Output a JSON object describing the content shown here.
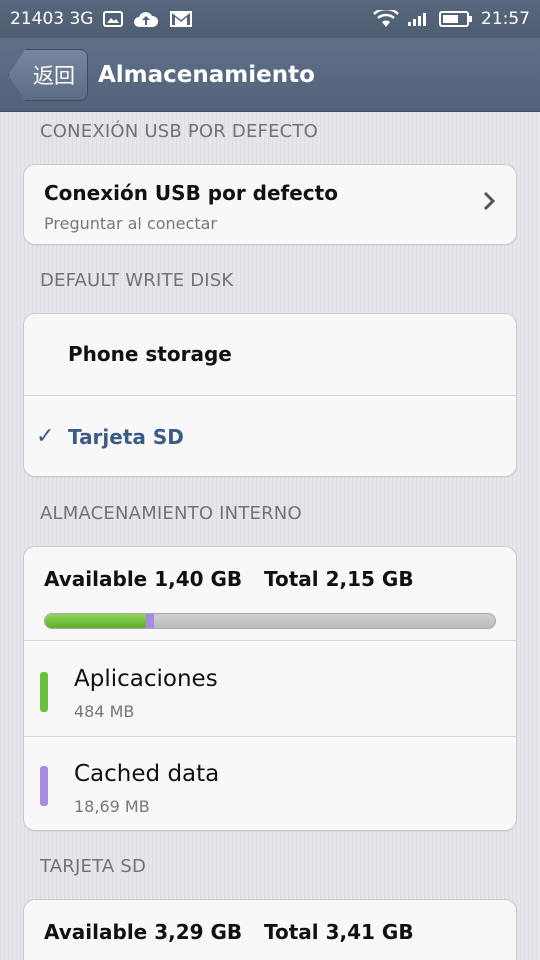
{
  "status_bar": {
    "carrier": "21403 3G",
    "time": "21:57",
    "icons": [
      "image-icon",
      "cloud-upload-icon",
      "gmail-icon",
      "wifi-icon",
      "signal-icon",
      "battery-icon"
    ]
  },
  "title_bar": {
    "back_label": "返回",
    "title": "Almacenamiento"
  },
  "sections": {
    "usb": {
      "header": "CONEXIÓN USB POR DEFECTO",
      "item_title": "Conexión USB por defecto",
      "item_subtitle": "Preguntar al conectar"
    },
    "write_disk": {
      "header": "DEFAULT WRITE DISK",
      "options": [
        {
          "label": "Phone storage",
          "selected": false
        },
        {
          "label": "Tarjeta SD",
          "selected": true
        }
      ],
      "check_glyph": "✓"
    },
    "internal": {
      "header": "ALMACENAMIENTO INTERNO",
      "available": "Available 1,40 GB",
      "total": "Total 2,15 GB",
      "usage": {
        "apps_fraction": 0.225,
        "cache_fraction": 0.018
      },
      "items": [
        {
          "title": "Aplicaciones",
          "size": "484 MB",
          "color": "#6cc13a"
        },
        {
          "title": "Cached data",
          "size": "18,69 MB",
          "color": "#a78be0"
        }
      ]
    },
    "sd": {
      "header": "TARJETA SD",
      "available": "Available 3,29 GB",
      "total": "Total 3,41 GB"
    }
  },
  "colors": {
    "accent": "#3b5a85",
    "apps": "#6cc13a",
    "cache": "#a78be0",
    "status_bar": "#55647a"
  }
}
